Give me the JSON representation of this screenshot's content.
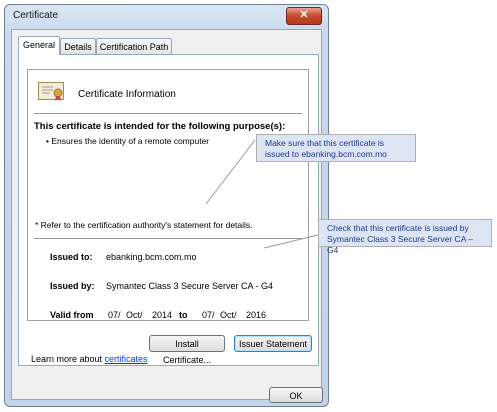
{
  "window": {
    "title": "Certificate",
    "close_glyph": "✕"
  },
  "tabs": [
    {
      "label": "General"
    },
    {
      "label": "Details"
    },
    {
      "label": "Certification Path"
    }
  ],
  "info": {
    "title": "Certificate Information",
    "purpose_heading": "This certificate is intended for the following purpose(s):",
    "purpose_item": "• Ensures the identity of a remote computer",
    "refer_note": "* Refer to the certification authority's statement for details.",
    "issued_to_label": "Issued to:",
    "issued_to_value": "ebanking.bcm.com.mo",
    "issued_by_label": "Issued by:",
    "issued_by_value": "Symantec Class 3 Secure Server CA - G4",
    "valid_from_label": "Valid from",
    "valid_from_day": "07/",
    "valid_from_month": "Oct/",
    "valid_from_year": "2014",
    "valid_to_label": "to",
    "valid_to_day": "07/",
    "valid_to_month": "Oct/",
    "valid_to_year": "2016"
  },
  "buttons": {
    "install": "Install Certificate...",
    "issuer": "Issuer Statement",
    "ok": "OK"
  },
  "learn": {
    "prefix": "Learn more about ",
    "link": "certificates"
  },
  "callouts": {
    "first": "Make sure that this certificate is issued to ebanking.bcm.com.mo",
    "second": "Check that this certificate is issued by Symantec Class 3 Secure Server CA – G4"
  },
  "colors": {
    "callout_bg": "#dde4f4",
    "callout_text": "#1f3a8a",
    "link": "#0044cc",
    "close_button": "#c9462c"
  }
}
